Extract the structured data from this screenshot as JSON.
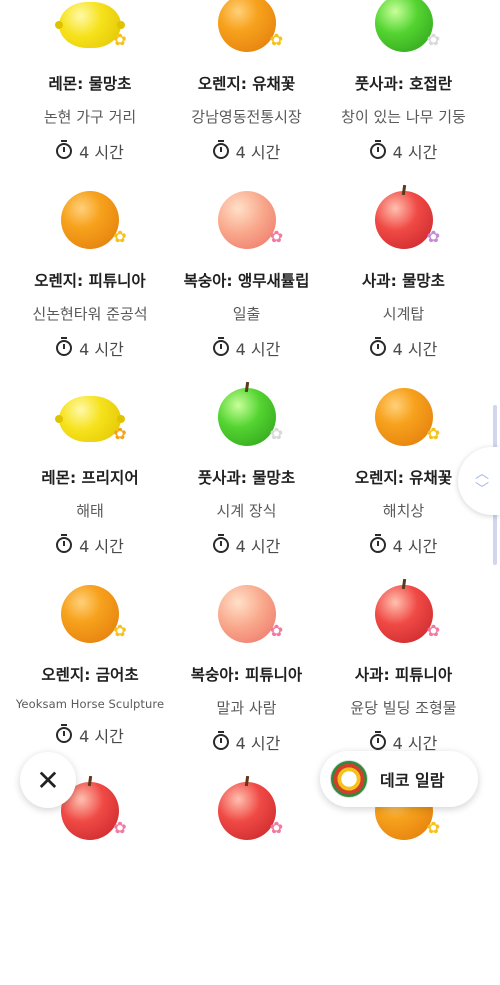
{
  "items": [
    {
      "name": "레몬: 물망초",
      "location": "논현 가구 거리",
      "time": "4 시간",
      "fruit": "lemon",
      "flower": "yellow"
    },
    {
      "name": "오렌지: 유채꽃",
      "location": "강남영동전통시장",
      "time": "4 시간",
      "fruit": "orange",
      "flower": "yellow"
    },
    {
      "name": "풋사과: 호접란",
      "location": "창이 있는 나무 기둥",
      "time": "4 시간",
      "fruit": "green",
      "flower": "white"
    },
    {
      "name": "오렌지: 피튜니아",
      "location": "신논현타워 준공석",
      "time": "4 시간",
      "fruit": "orange",
      "flower": "yellow"
    },
    {
      "name": "복숭아: 앵무새튤립",
      "location": "일출",
      "time": "4 시간",
      "fruit": "peach",
      "flower": "pink"
    },
    {
      "name": "사과: 물망초",
      "location": "시계탑",
      "time": "4 시간",
      "fruit": "apple",
      "flower": "purple"
    },
    {
      "name": "레몬: 프리지어",
      "location": "해태",
      "time": "4 시간",
      "fruit": "lemon",
      "flower": "orange"
    },
    {
      "name": "풋사과: 물망초",
      "location": "시계 장식",
      "time": "4 시간",
      "fruit": "green",
      "flower": "white"
    },
    {
      "name": "오렌지: 유채꽃",
      "location": "해치상",
      "time": "4 시간",
      "fruit": "orange",
      "flower": "yellow"
    },
    {
      "name": "오렌지: 금어초",
      "location": "Yeoksam Horse Sculpture",
      "time": "4 시간",
      "fruit": "orange",
      "flower": "yellow"
    },
    {
      "name": "복숭아: 피튜니아",
      "location": "말과 사람",
      "time": "4 시간",
      "fruit": "peach",
      "flower": "pink"
    },
    {
      "name": "사과: 피튜니아",
      "location": "윤당 빌딩 조형물",
      "time": "4 시간",
      "fruit": "apple",
      "flower": "pink"
    },
    {
      "name": "",
      "location": "",
      "time": "",
      "fruit": "apple",
      "flower": "pink"
    },
    {
      "name": "",
      "location": "",
      "time": "",
      "fruit": "apple",
      "flower": "pink"
    },
    {
      "name": "",
      "location": "",
      "time": "",
      "fruit": "orange",
      "flower": "yellow"
    }
  ],
  "buttons": {
    "close_label": "✕",
    "deco_label": "데코 일람"
  },
  "icons": {
    "timer": "timer-icon",
    "flower": "flower-icon",
    "deco": "deco-wreath-icon"
  },
  "colors": {
    "scroll_accent": "#a8b6e8"
  }
}
